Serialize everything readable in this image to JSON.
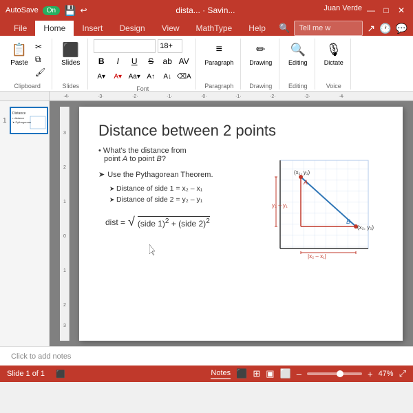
{
  "titlebar": {
    "autosave_label": "AutoSave",
    "toggle_state": "On",
    "filename": "dista... · Savin...",
    "user": "Juan Verde",
    "minimize": "—",
    "maximize": "□",
    "close": "✕"
  },
  "ribbon": {
    "tabs": [
      "File",
      "Home",
      "Insert",
      "Design",
      "View",
      "MathType",
      "Help"
    ],
    "active_tab": "Home",
    "search_placeholder": "Tell me w",
    "groups": {
      "clipboard": "Clipboard",
      "slides": "Slides",
      "font": "Font",
      "paragraph": "Paragraph",
      "drawing": "Drawing",
      "editing": "Editing",
      "voice": "Voice"
    },
    "font_name": "",
    "font_size": "18+",
    "paste_label": "Paste",
    "slides_label": "Slides",
    "dictate_label": "Dictate"
  },
  "slide": {
    "title": "Distance between 2 points",
    "bullet1": "What's the distance from",
    "bullet1b": "point ",
    "bullet1c": "A",
    "bullet1d": " to point ",
    "bullet1e": "B",
    "bullet1f": "?",
    "theorem_intro": "Use the Pythagorean Theorem.",
    "side1": "Distance of side 1 = x₂ – x₁",
    "side2": "Distance of side 2 = y₂ – y₁",
    "formula_label": "dist =",
    "formula_sqrt": "√",
    "formula_body": "(side 1)² + (side 2)²",
    "number": "1"
  },
  "status": {
    "slide_info": "Slide 1 of 1",
    "notes_label": "Notes",
    "zoom": "47%"
  },
  "notes_bar": {
    "placeholder": "Click to add notes"
  },
  "notes_tab": {
    "label": "Notes"
  }
}
